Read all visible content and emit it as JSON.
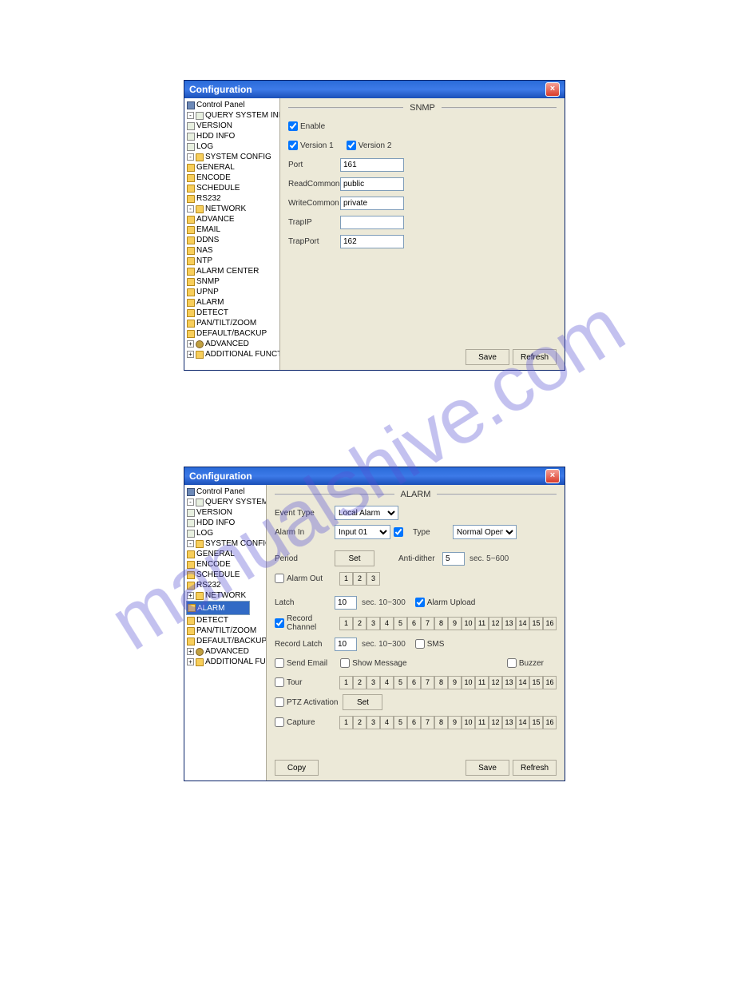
{
  "window1": {
    "title": "Configuration",
    "section": "SNMP",
    "tree": {
      "root": "Control Panel",
      "n0": "QUERY SYSTEM INFO",
      "n0_0": "VERSION",
      "n0_1": "HDD INFO",
      "n0_2": "LOG",
      "n1": "SYSTEM CONFIG",
      "n1_0": "GENERAL",
      "n1_1": "ENCODE",
      "n1_2": "SCHEDULE",
      "n1_3": "RS232",
      "n1_4": "NETWORK",
      "n1_4_0": "ADVANCE",
      "n1_4_1": "EMAIL",
      "n1_4_2": "DDNS",
      "n1_4_3": "NAS",
      "n1_4_4": "NTP",
      "n1_4_5": "ALARM CENTER",
      "n1_4_6": "SNMP",
      "n1_4_7": "UPNP",
      "n1_5": "ALARM",
      "n1_6": "DETECT",
      "n1_7": "PAN/TILT/ZOOM",
      "n1_8": "DEFAULT/BACKUP",
      "n2": "ADVANCED",
      "n3": "ADDITIONAL FUNCTION"
    },
    "form": {
      "enable": "Enable",
      "version1": "Version 1",
      "version2": "Version 2",
      "port_lbl": "Port",
      "port_val": "161",
      "readcommon_lbl": "ReadCommon",
      "readcommon_val": "public",
      "writecommon_lbl": "WriteCommon",
      "writecommon_val": "private",
      "trapip_lbl": "TrapIP",
      "trapip_val": "",
      "trapport_lbl": "TrapPort",
      "trapport_val": "162"
    },
    "buttons": {
      "save": "Save",
      "refresh": "Refresh"
    }
  },
  "window2": {
    "title": "Configuration",
    "section": "ALARM",
    "tree": {
      "root": "Control Panel",
      "n0": "QUERY SYSTEM INFO",
      "n0_0": "VERSION",
      "n0_1": "HDD INFO",
      "n0_2": "LOG",
      "n1": "SYSTEM CONFIG",
      "n1_0": "GENERAL",
      "n1_1": "ENCODE",
      "n1_2": "SCHEDULE",
      "n1_3": "RS232",
      "n1_4": "NETWORK",
      "n1_5": "ALARM",
      "n1_6": "DETECT",
      "n1_7": "PAN/TILT/ZOOM",
      "n1_8": "DEFAULT/BACKUP",
      "n2": "ADVANCED",
      "n3": "ADDITIONAL FUNCTION"
    },
    "form": {
      "eventtype_lbl": "Event Type",
      "eventtype_val": "Local Alarm",
      "alarmin_lbl": "Alarm In",
      "alarmin_val": "Input 01",
      "type_lbl": "Type",
      "type_val": "Normal Open",
      "period_lbl": "Period",
      "set_btn": "Set",
      "antidither_lbl": "Anti-dither",
      "antidither_val": "5",
      "antidither_hint": "sec.    5~600",
      "alarmout_lbl": "Alarm Out",
      "alarmout_1": "1",
      "alarmout_2": "2",
      "alarmout_3": "3",
      "latch_lbl": "Latch",
      "latch_val": "10",
      "latch_hint": "sec.    10~300",
      "alarmupload_lbl": "Alarm Upload",
      "recordchannel_lbl": "Record Channel",
      "recordlatch_lbl": "Record Latch",
      "recordlatch_val": "10",
      "recordlatch_hint": "sec.    10~300",
      "sms_lbl": "SMS",
      "sendemail_lbl": "Send Email",
      "showmessage_lbl": "Show Message",
      "buzzer_lbl": "Buzzer",
      "tour_lbl": "Tour",
      "ptz_lbl": "PTZ Activation",
      "capture_lbl": "Capture",
      "ch": [
        "1",
        "2",
        "3",
        "4",
        "5",
        "6",
        "7",
        "8",
        "9",
        "10",
        "11",
        "12",
        "13",
        "14",
        "15",
        "16"
      ]
    },
    "buttons": {
      "copy": "Copy",
      "save": "Save",
      "refresh": "Refresh"
    }
  }
}
